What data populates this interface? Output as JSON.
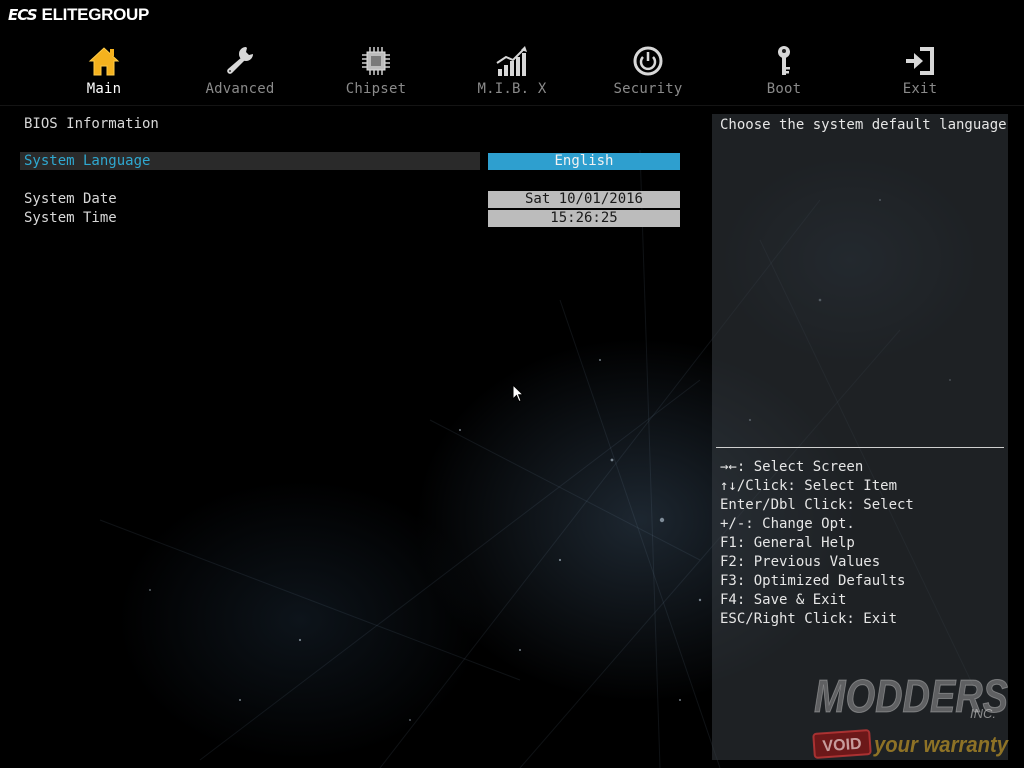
{
  "brand": {
    "mark": "ECS",
    "name": "ELITEGROUP"
  },
  "nav": {
    "tabs": [
      {
        "label": "Main",
        "icon": "home-icon",
        "active": true
      },
      {
        "label": "Advanced",
        "icon": "wrench-icon",
        "active": false
      },
      {
        "label": "Chipset",
        "icon": "chip-icon",
        "active": false
      },
      {
        "label": "M.I.B. X",
        "icon": "performance-chart-icon",
        "active": false
      },
      {
        "label": "Security",
        "icon": "power-lock-icon",
        "active": false
      },
      {
        "label": "Boot",
        "icon": "key-icon",
        "active": false
      },
      {
        "label": "Exit",
        "icon": "exit-door-icon",
        "active": false
      }
    ]
  },
  "main": {
    "section_title": "BIOS Information",
    "settings": [
      {
        "label": "System Language",
        "value": "English",
        "selected": true
      },
      {
        "label": "System Date",
        "value": "Sat 10/01/2016",
        "selected": false
      },
      {
        "label": "System Time",
        "value": "15:26:25",
        "selected": false
      }
    ]
  },
  "help": {
    "description": "Choose the system default language",
    "keys": [
      "→←: Select Screen",
      "↑↓/Click: Select Item",
      "Enter/Dbl Click: Select",
      "+/-: Change Opt.",
      "F1: General Help",
      "F2: Previous Values",
      "F3: Optimized Defaults",
      "F4: Save & Exit",
      "ESC/Right Click: Exit"
    ]
  },
  "watermark": {
    "line1": "MODDERS",
    "line1_sub": "INC.",
    "stamp": "VOID",
    "line2": "your warranty"
  },
  "colors": {
    "accent": "#2e9fcf",
    "selected_text": "#2fa8d0",
    "active_icon": "#f5b21e",
    "inactive": "#8a8a8a",
    "value_box": "#bcbcbc"
  }
}
